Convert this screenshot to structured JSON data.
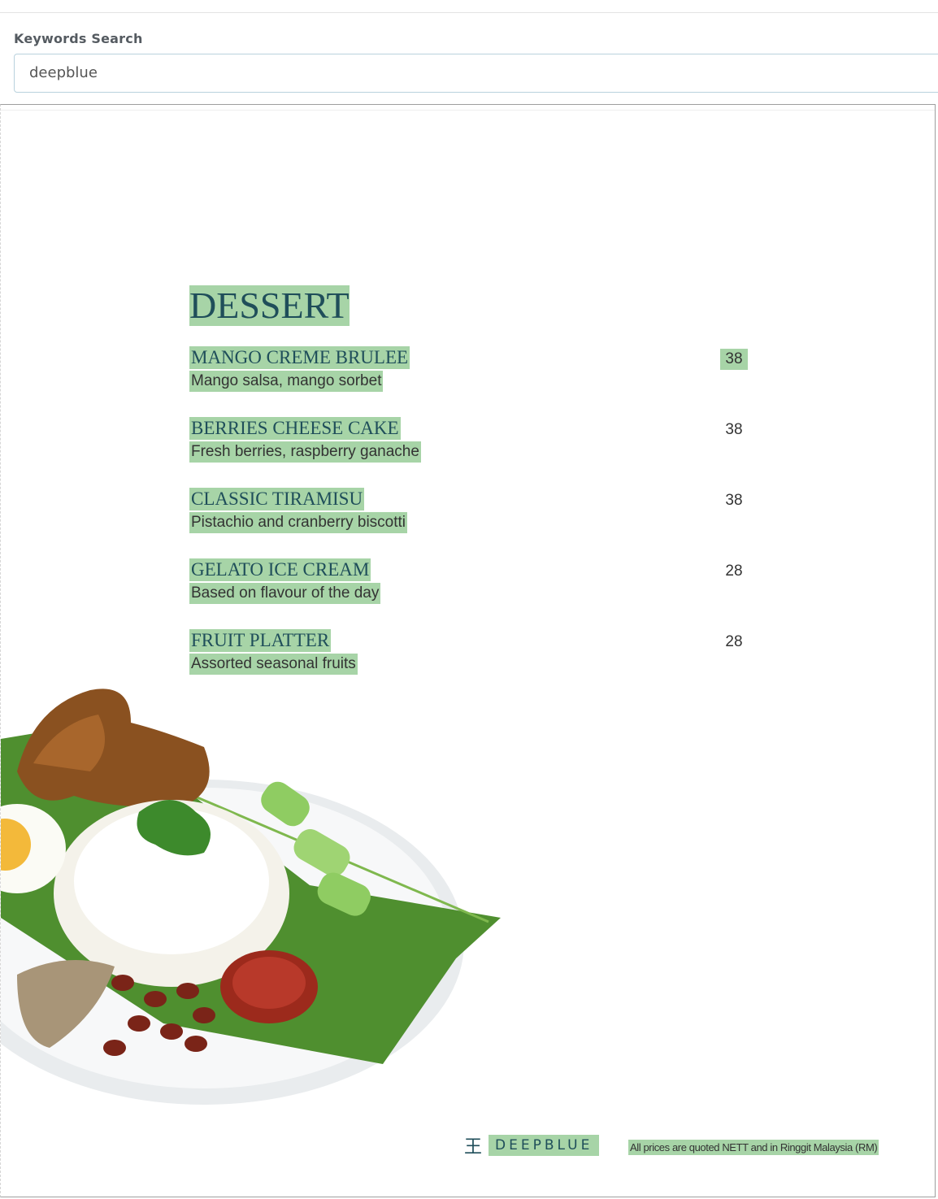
{
  "search": {
    "label": "Keywords Search",
    "value": "deepblue"
  },
  "menu": {
    "section_title": "DESSERT",
    "items": [
      {
        "name": "MANGO CREME BRULEE",
        "desc": "Mango salsa, mango sorbet",
        "price": "38"
      },
      {
        "name": "BERRIES CHEESE CAKE",
        "desc": "Fresh berries, raspberry ganache",
        "price": "38"
      },
      {
        "name": "CLASSIC TIRAMISU",
        "desc": "Pistachio and cranberry biscotti",
        "price": "38"
      },
      {
        "name": "GELATO ICE CREAM",
        "desc": "Based on flavour of the day",
        "price": "28"
      },
      {
        "name": "FRUIT PLATTER",
        "desc": "Assorted seasonal fruits",
        "price": "28"
      }
    ],
    "brand": "DEEPBLUE",
    "footer_note": "All prices are quoted NETT and in Ringgit Malaysia (RM)"
  },
  "colors": {
    "highlight": "#5eb15e",
    "title": "#1f4e5a",
    "input_border": "#b9d2dd"
  }
}
